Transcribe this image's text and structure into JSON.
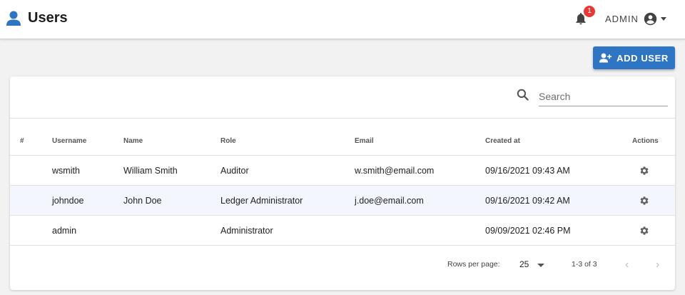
{
  "header": {
    "title": "Users",
    "title_icon": "person-icon",
    "notification_count": "1",
    "account_label": "ADMIN"
  },
  "toolbar": {
    "add_user_label": "ADD USER",
    "search_placeholder": "Search",
    "search_value": ""
  },
  "table": {
    "columns": [
      "#",
      "Username",
      "Name",
      "Role",
      "Email",
      "Created at",
      "Actions"
    ],
    "rows": [
      {
        "username": "wsmith",
        "name": "William Smith",
        "role": "Auditor",
        "email": "w.smith@email.com",
        "created_at": "09/16/2021 09:43 AM"
      },
      {
        "username": "johndoe",
        "name": "John Doe",
        "role": "Ledger Administrator",
        "email": "j.doe@email.com",
        "created_at": "09/16/2021 09:42 AM"
      },
      {
        "username": "admin",
        "name": "",
        "role": "Administrator",
        "email": "",
        "created_at": "09/09/2021 02:46 PM"
      }
    ]
  },
  "pagination": {
    "rows_per_page_label": "Rows per page:",
    "rows_per_page_value": "25",
    "range_label": "1-3 of 3"
  },
  "colors": {
    "primary": "#2e75c3",
    "badge": "#e53935",
    "row_highlight": "#f3f7fd"
  }
}
